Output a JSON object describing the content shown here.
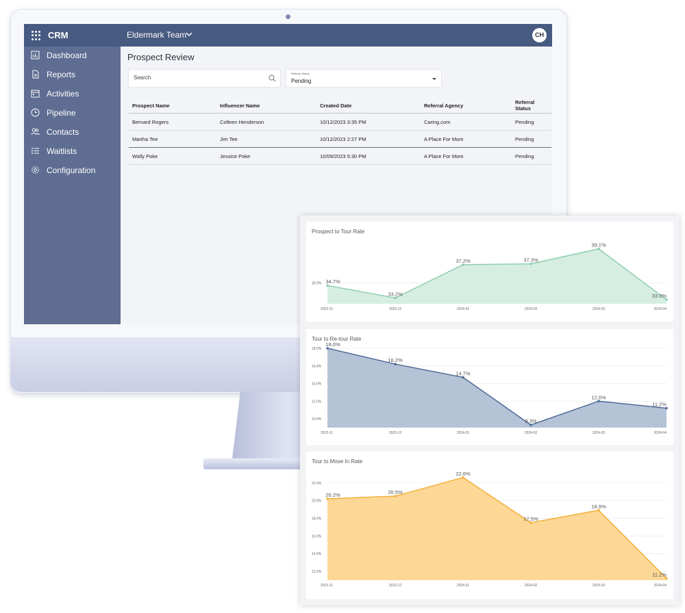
{
  "app": {
    "title": "CRM",
    "team": "Eldermark Team",
    "avatar_initials": "CH",
    "header_color": "#475a80",
    "sidebar_color": "#5e6d91"
  },
  "sidebar": {
    "items": [
      {
        "label": "Dashboard",
        "icon": "bar-chart-icon"
      },
      {
        "label": "Reports",
        "icon": "document-icon"
      },
      {
        "label": "Activities",
        "icon": "calendar-icon"
      },
      {
        "label": "Pipeline",
        "icon": "clock-icon"
      },
      {
        "label": "Contacts",
        "icon": "people-icon"
      },
      {
        "label": "Waitlists",
        "icon": "list-icon"
      },
      {
        "label": "Configuration",
        "icon": "gear-icon"
      }
    ]
  },
  "main": {
    "title": "Prospect Review",
    "search_placeholder": "Search",
    "status_filter": {
      "label": "Referral Status",
      "value": "Pending"
    },
    "table": {
      "columns": [
        "Prospect Name",
        "Influencer Name",
        "Created Date",
        "Referral Agency",
        "Referral Status"
      ],
      "rows": [
        [
          "Bernard Rogers",
          "Colleen Henderson",
          "10/12/2023 3:35 PM",
          "Caring.com",
          "Pending"
        ],
        [
          "Martha Tee",
          "Jim Tee",
          "10/12/2023 2:27 PM",
          "A Place For Mom",
          "Pending"
        ],
        [
          "Wally Poke",
          "Jessice Poke",
          "10/09/2023 5:30 PM",
          "A Place For Mom",
          "Pending"
        ]
      ]
    }
  },
  "chart_data": [
    {
      "type": "area",
      "title": "Prospect to Tour Rate",
      "x": [
        "2023-11",
        "2023-12",
        "2024-01",
        "2024-02",
        "2024-03",
        "2024-04"
      ],
      "values": [
        34.7,
        33.2,
        37.2,
        37.3,
        39.1,
        33.0
      ],
      "labels": [
        "34.7%",
        "33.2%",
        "37.2%",
        "37.3%",
        "39.1%",
        "33.0%"
      ],
      "yticks": [
        "35.0%"
      ],
      "ylim": [
        32.5,
        39.9
      ],
      "color": "#8ecfb0",
      "fill": "#d6ede1"
    },
    {
      "type": "area",
      "title": "Tour to Re-tour Rate",
      "x": [
        "2023-11",
        "2023-12",
        "2024-01",
        "2024-02",
        "2024-03",
        "2024-04"
      ],
      "values": [
        18.0,
        16.2,
        14.7,
        9.3,
        12.0,
        11.2
      ],
      "labels": [
        "18.0%",
        "16.2%",
        "14.7%",
        "9.3%",
        "12.0%",
        "11.2%"
      ],
      "yticks": [
        "10.0%",
        "12.0%",
        "14.0%",
        "16.0%",
        "18.0%"
      ],
      "ylim": [
        9.0,
        18.0
      ],
      "color": "#4f6a96",
      "fill": "#b5c3d7"
    },
    {
      "type": "area",
      "title": "Tour to Move In Rate",
      "x": [
        "2023-11",
        "2023-12",
        "2024-01",
        "2024-02",
        "2024-03",
        "2024-04"
      ],
      "values": [
        20.2,
        20.5,
        22.6,
        17.5,
        18.9,
        11.2
      ],
      "labels": [
        "20.2%",
        "20.5%",
        "22.6%",
        "17.5%",
        "18.9%",
        "11.2%"
      ],
      "yticks": [
        "12.0%",
        "14.0%",
        "16.0%",
        "18.0%",
        "20.0%",
        "22.0%"
      ],
      "ylim": [
        11.0,
        22.6
      ],
      "color": "#f2b13b",
      "fill": "#fcd796"
    }
  ]
}
